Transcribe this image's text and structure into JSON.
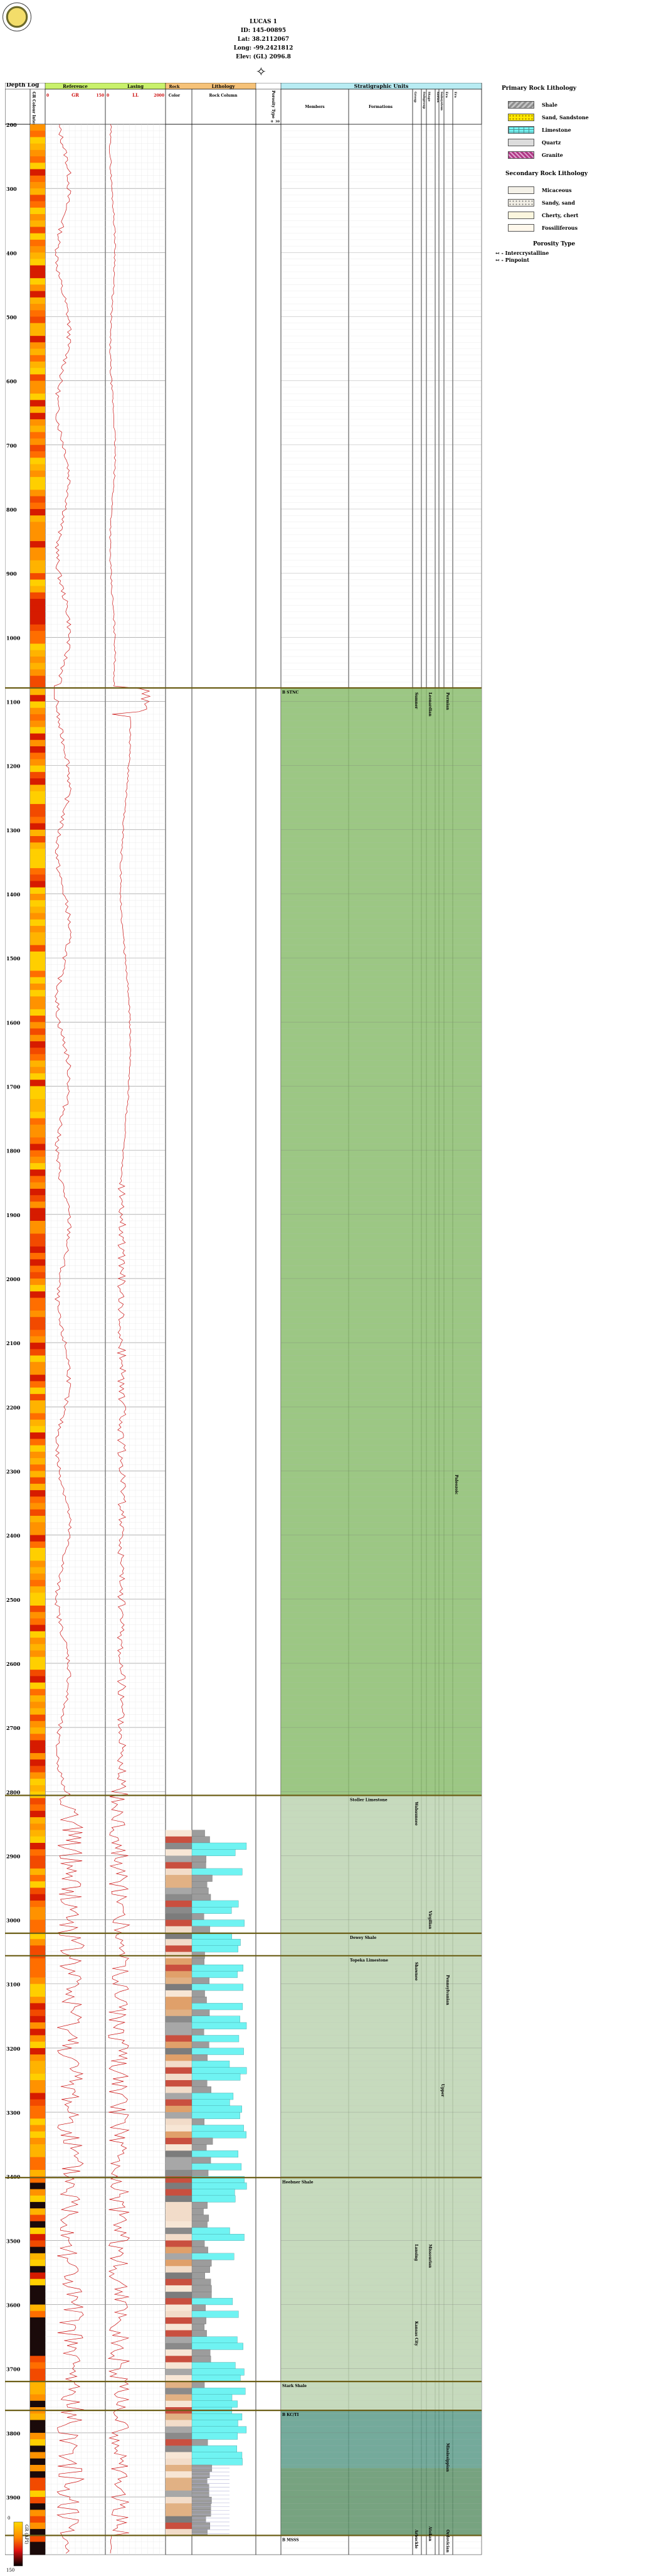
{
  "header": {
    "name": "LUCAS 1",
    "id": "ID: 145-00895",
    "lat": "Lat: 38.2112067",
    "long": "Long: -99.2421812",
    "elev": "Elev: (GL) 2096.8"
  },
  "columns": {
    "depth_log": "Depth Log",
    "gr_colour": "GR Colour Intensity",
    "reference": "Reference",
    "gr_label": "GR",
    "gr_min": "0",
    "gr_max": "150",
    "lasing": "Lasing",
    "ll_label": "LL",
    "ll_min": "0",
    "ll_max": "2000",
    "rock_colour_header": "Rock",
    "colour_sub": "Color",
    "lithology": "Lithology",
    "rock_column": "Rock Column",
    "porosity_type": "Porosity Type",
    "porosity_min": "0",
    "porosity_max": "30",
    "strat_units": "Stratigraphic Units",
    "members": "Members",
    "formations": "Formations",
    "group": "Group",
    "subgroup": "Subgroup",
    "stage": "Stage",
    "series": "Series",
    "subsystem": "Subsystem",
    "system": "Era"
  },
  "depth_ticks": [
    "200",
    "300",
    "400",
    "500",
    "600",
    "700",
    "800",
    "900",
    "1000",
    "1100",
    "1200",
    "1300",
    "1400",
    "1500",
    "1600",
    "1700",
    "1800",
    "1900",
    "2000",
    "2100",
    "2200",
    "2300",
    "2400",
    "2500",
    "2600",
    "2700",
    "2800",
    "2900",
    "3000",
    "3100",
    "3200",
    "3300",
    "3400",
    "3500",
    "3600",
    "3700",
    "3800",
    "3900"
  ],
  "tops": [
    {
      "depth": 1079,
      "label": "B STNC",
      "col": "members"
    },
    {
      "depth": 2806,
      "label": "Stoller Limestone",
      "col": "formations"
    },
    {
      "depth": 3021,
      "label": "Dewey Shale",
      "col": "formations"
    },
    {
      "depth": 3056,
      "label": "Topeka Limestone",
      "col": "formations"
    },
    {
      "depth": 3402,
      "label": "Heebner Shale",
      "col": "members"
    },
    {
      "depth": 3720,
      "label": "Stark Shale",
      "col": "members"
    },
    {
      "depth": 3765,
      "label": "B KC/TI",
      "col": "members"
    },
    {
      "depth": 3960,
      "label": "B MSSS",
      "col": "members"
    }
  ],
  "vertical_units": [
    {
      "label": "Sumner",
      "col": "group",
      "depth_from": 1080,
      "depth_to": 1300
    },
    {
      "label": "Leonardian",
      "col": "stage",
      "depth_from": 1080,
      "depth_to": 1300
    },
    {
      "label": "Permian",
      "col": "system",
      "depth_from": 1080,
      "depth_to": 1180
    },
    {
      "label": "Paleozoic",
      "col": "era",
      "depth_from": 2300,
      "depth_to": 2500
    },
    {
      "label": "Wabaunsee",
      "col": "group",
      "depth_from": 2810,
      "depth_to": 3000
    },
    {
      "label": "Shawnee",
      "col": "group",
      "depth_from": 3060,
      "depth_to": 3380
    },
    {
      "label": "Virgilian",
      "col": "stage",
      "depth_from": 2980,
      "depth_to": 3210
    },
    {
      "label": "Pennsylvanian",
      "col": "system",
      "depth_from": 3080,
      "depth_to": 3330
    },
    {
      "label": "Upper",
      "col": "subsystem",
      "depth_from": 3250,
      "depth_to": 3350
    },
    {
      "label": "Lansing",
      "col": "group",
      "depth_from": 3500,
      "depth_to": 3640
    },
    {
      "label": "Kansas City",
      "col": "group",
      "depth_from": 3620,
      "depth_to": 3700
    },
    {
      "label": "Missourian",
      "col": "stage",
      "depth_from": 3500,
      "depth_to": 3680
    },
    {
      "label": "Mississippian",
      "col": "system",
      "depth_from": 3810,
      "depth_to": 3920
    },
    {
      "label": "Atokan",
      "col": "stage",
      "depth_from": 3940,
      "depth_to": 3968
    },
    {
      "label": "Ordovician",
      "col": "system",
      "depth_from": 3945,
      "depth_to": 3975
    },
    {
      "label": "Arbuckle",
      "col": "group",
      "depth_from": 3945,
      "depth_to": 3975
    }
  ],
  "legend": {
    "primary_title": "Primary Rock Lithology",
    "primary": [
      {
        "label": "Shale",
        "swatch": "sw-shale"
      },
      {
        "label": "Sand, Sandstone",
        "swatch": "sw-sand"
      },
      {
        "label": "Limestone",
        "swatch": "sw-lime"
      },
      {
        "label": "Quartz",
        "swatch": "sw-quartz"
      },
      {
        "label": "Granite",
        "swatch": "sw-granite"
      }
    ],
    "secondary_title": "Secondary Rock Lithology",
    "secondary": [
      {
        "label": "Micaceous",
        "swatch": "sw-micro"
      },
      {
        "label": "Sandy, sand",
        "swatch": "sw-sandy"
      },
      {
        "label": "Cherty, chert",
        "swatch": "sw-cherty"
      },
      {
        "label": "Fossiliferous",
        "swatch": "sw-foss"
      }
    ],
    "porosity_title": "Porosity Type",
    "porosity": [
      {
        "label": "- Intercrystalline"
      },
      {
        "label": "- Pinpoint"
      }
    ]
  },
  "bottom_scale": {
    "label": "GR (API)",
    "min": "0",
    "max": "150"
  },
  "colors": {
    "curve": "#cc1111",
    "top_line": "#6b5e16",
    "permian_fill": "#8bbd6e",
    "penn_fill": "#bcd3b1",
    "mississippian_fill": "#5c9b8a",
    "arbuckle_fill": "#5f936a"
  }
}
